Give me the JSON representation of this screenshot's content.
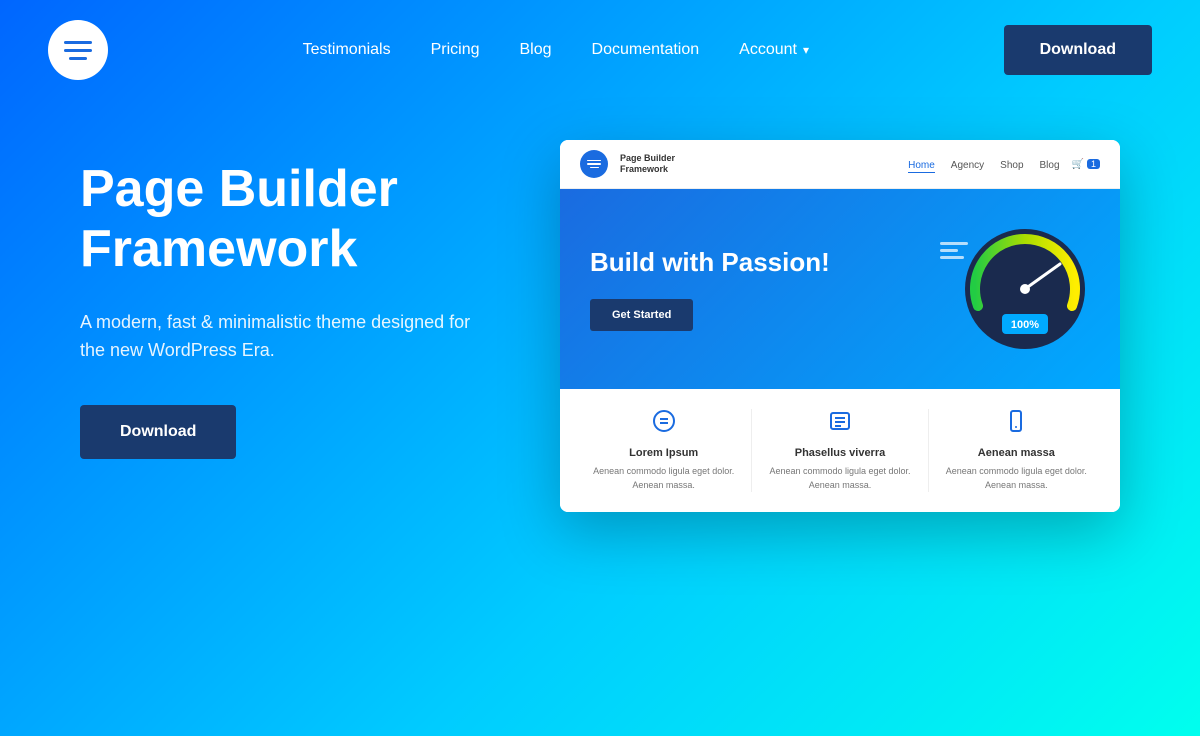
{
  "nav": {
    "links": [
      {
        "label": "Testimonials",
        "id": "testimonials"
      },
      {
        "label": "Pricing",
        "id": "pricing"
      },
      {
        "label": "Blog",
        "id": "blog"
      },
      {
        "label": "Documentation",
        "id": "documentation"
      }
    ],
    "account_label": "Account",
    "download_label": "Download"
  },
  "hero": {
    "title": "Page Builder Framework",
    "subtitle": "A modern, fast & minimalistic theme designed for the new WordPress Era.",
    "download_label": "Download"
  },
  "preview": {
    "brand": "Page Builder\nFramework",
    "mini_nav": [
      {
        "label": "Home",
        "active": true
      },
      {
        "label": "Agency",
        "active": false
      },
      {
        "label": "Shop",
        "active": false
      },
      {
        "label": "Blog",
        "active": false
      }
    ],
    "cart_count": "1",
    "hero_title": "Build with Passion!",
    "get_started_label": "Get Started",
    "speed_value": "100%",
    "features": [
      {
        "icon": "⊟",
        "title": "Lorem Ipsum",
        "desc": "Aenean commodo ligula eget dolor. Aenean massa."
      },
      {
        "icon": "☰",
        "title": "Phasellus viverra",
        "desc": "Aenean commodo ligula eget dolor. Aenean massa."
      },
      {
        "icon": "📱",
        "title": "Aenean massa",
        "desc": "Aenean commodo ligula eget dolor. Aenean massa."
      }
    ]
  }
}
